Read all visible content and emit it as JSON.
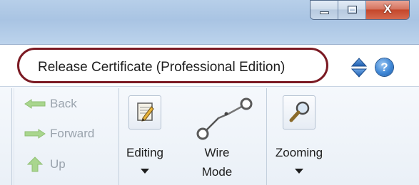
{
  "window": {
    "minimize_icon": "minimize-icon",
    "maximize_icon": "maximize-icon",
    "close_glyph": "X",
    "close_color": "#c8432a"
  },
  "header": {
    "title": "Release Certificate (Professional Edition)",
    "highlight_color": "#7b1a23",
    "collapse_icon": "up-down-arrows-icon",
    "help_glyph": "?"
  },
  "navigation": {
    "back_label": "Back",
    "forward_label": "Forward",
    "up_label": "Up"
  },
  "tools": {
    "editing_label": "Editing",
    "wire_mode_line1": "Wire",
    "wire_mode_line2": "Mode",
    "zooming_label": "Zooming"
  }
}
